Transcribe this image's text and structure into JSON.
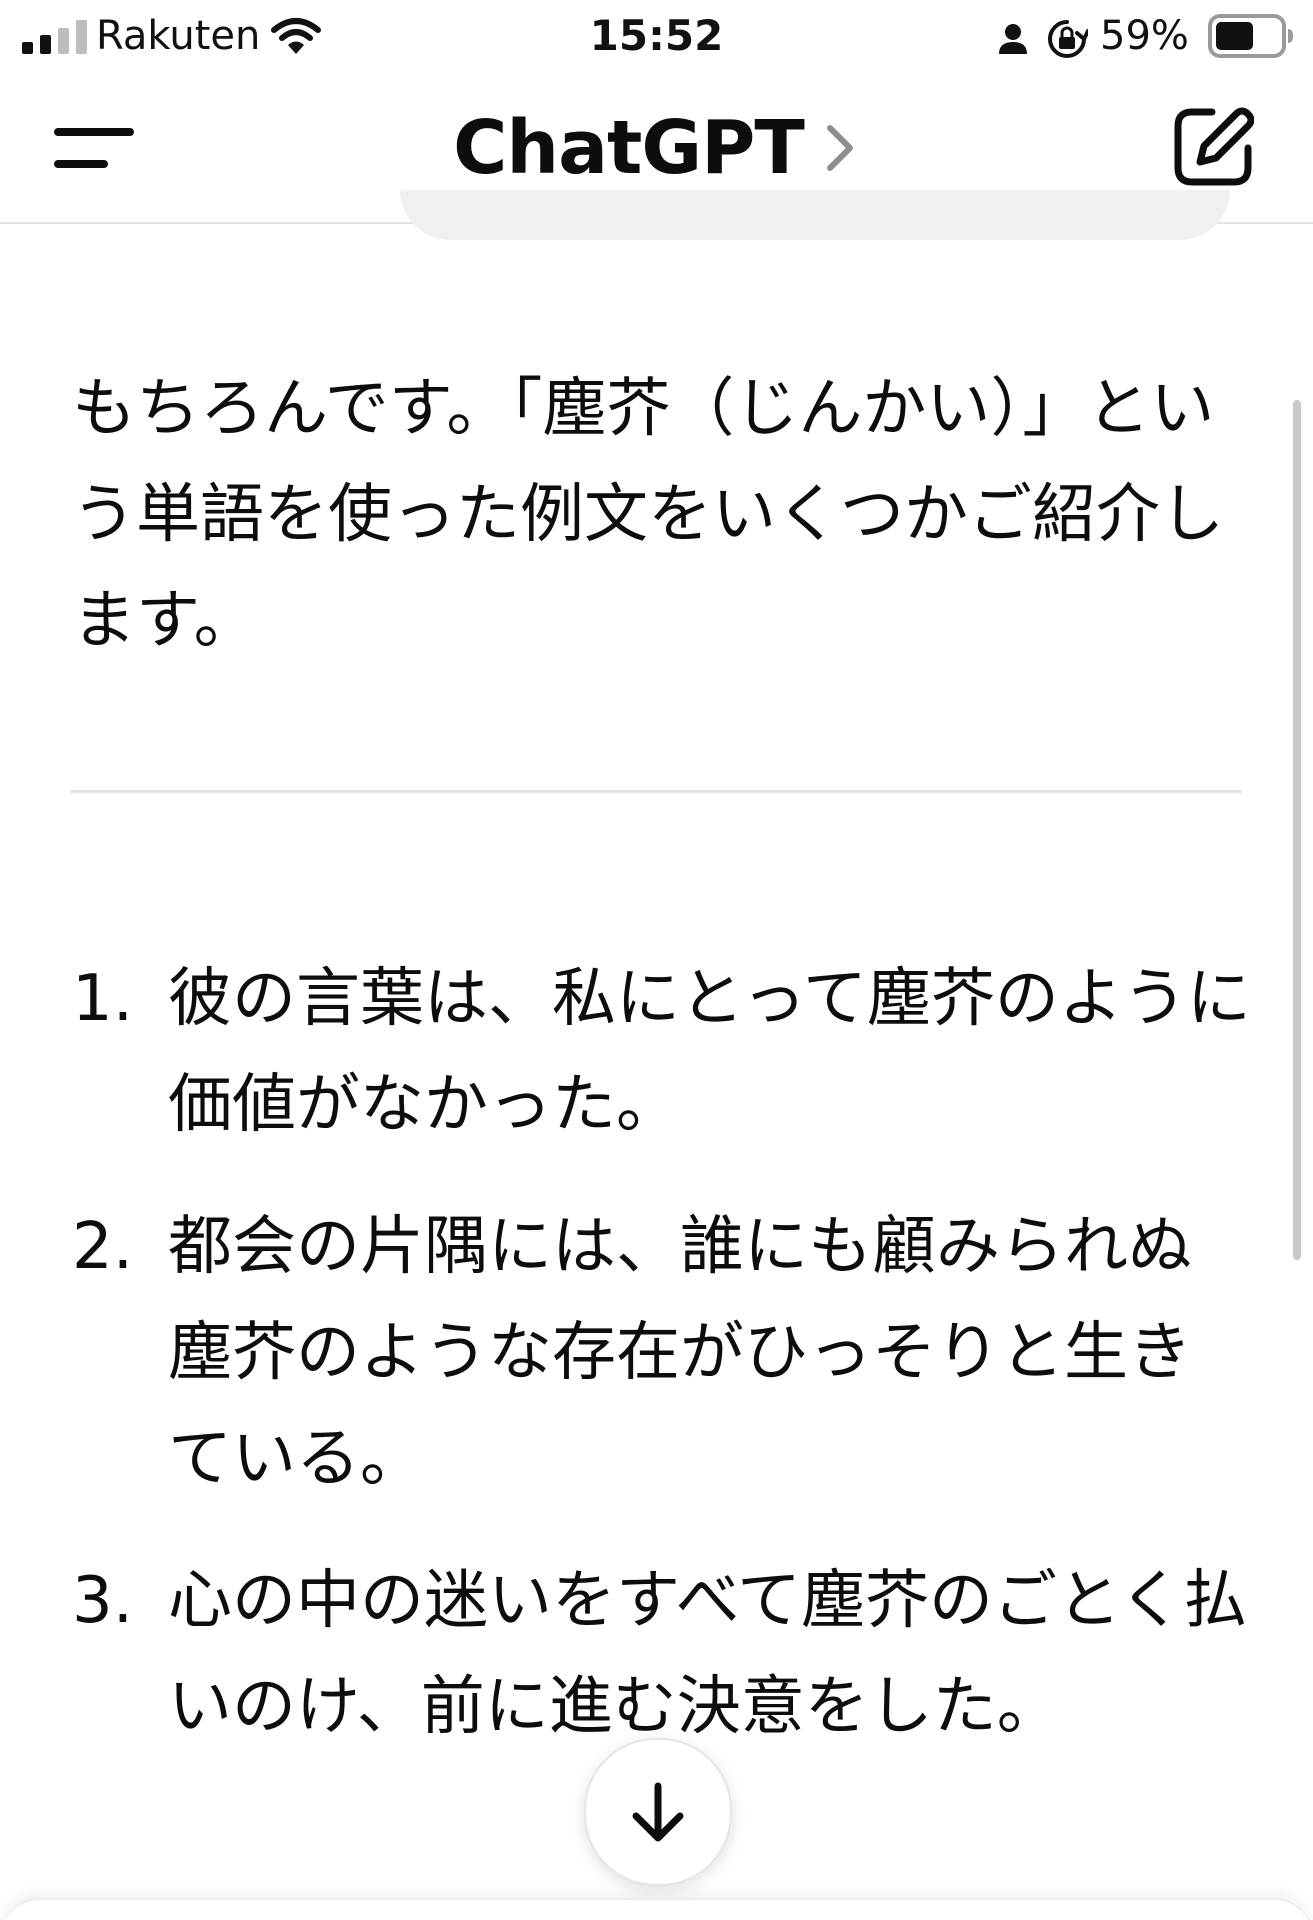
{
  "status_bar": {
    "carrier": "Rakuten",
    "time": "15:52",
    "battery_percent": "59%",
    "battery_level": 0.59,
    "icons": [
      "signal-icon",
      "wifi-icon",
      "person-icon",
      "orientation-lock-icon",
      "battery-icon"
    ]
  },
  "nav": {
    "title": "ChatGPT",
    "icons": [
      "menu-icon",
      "chevron-right-icon",
      "new-chat-icon"
    ]
  },
  "message": {
    "intro": "もちろんです。「塵芥（じんかい）」という単語を使った例文をいくつかご紹介します。",
    "examples": [
      {
        "number": "1.",
        "text": "彼の言葉は、私にとって塵芥のように価値がなかった。"
      },
      {
        "number": "2.",
        "text": "都会の片隅には、誰にも顧みられぬ塵芥のような存在がひっそりと生きている。"
      },
      {
        "number": "3.",
        "text": "心の中の迷いをすべて塵芥のごとく払いのけ、前に進む決意をした。"
      }
    ]
  },
  "scroll_down": {
    "icon": "arrow-down-icon"
  }
}
